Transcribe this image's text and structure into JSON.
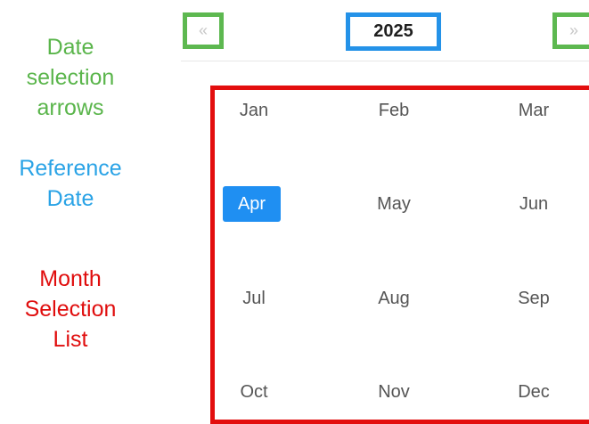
{
  "annotations": {
    "arrows": "Date\nselection\narrows",
    "reference": "Reference\nDate",
    "month_list": "Month\nSelection\nList"
  },
  "header": {
    "prev_icon": "«",
    "year": "2025",
    "next_icon": "»"
  },
  "months": [
    "Jan",
    "Feb",
    "Mar",
    "Apr",
    "May",
    "Jun",
    "Jul",
    "Aug",
    "Sep",
    "Oct",
    "Nov",
    "Dec"
  ],
  "selected_month": "Apr",
  "colors": {
    "arrows_annotation": "#5ab54b",
    "reference_annotation": "#2aa3e6",
    "month_annotation": "#e00d0d",
    "selected_bg": "#1f8ff2"
  }
}
